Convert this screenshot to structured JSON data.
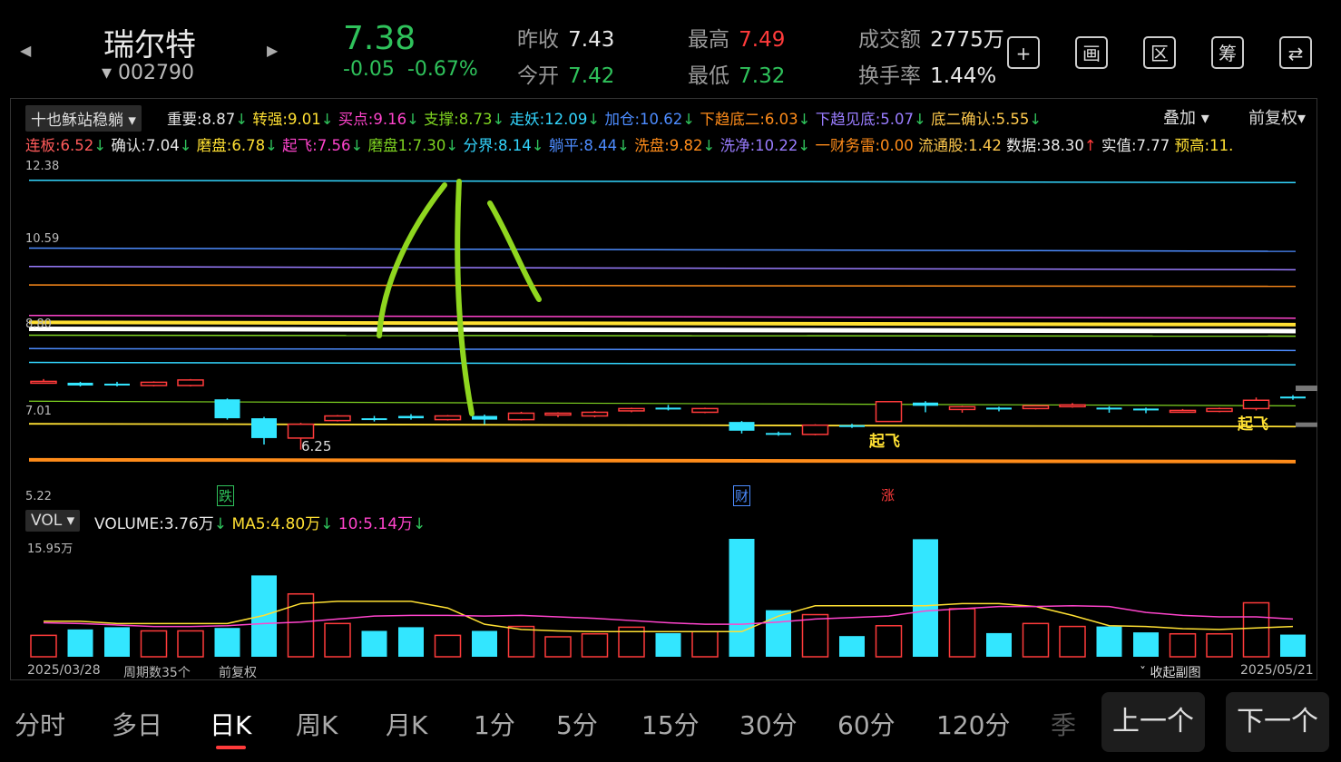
{
  "header": {
    "stock_name": "瑞尔特",
    "stock_code": "002790",
    "price": "7.38",
    "change": "-0.05",
    "change_pct": "-0.67%",
    "quotes": [
      {
        "label": "昨收",
        "value": "7.43",
        "color": "#e8e8e8"
      },
      {
        "label": "今开",
        "value": "7.42",
        "color": "#2fc25b"
      },
      {
        "label": "最高",
        "value": "7.49",
        "color": "#ff3b3b"
      },
      {
        "label": "最低",
        "value": "7.32",
        "color": "#2fc25b"
      },
      {
        "label": "成交额",
        "value": "2775万",
        "color": "#e8e8e8"
      },
      {
        "label": "换手率",
        "value": "1.44%",
        "color": "#e8e8e8"
      }
    ],
    "tools": [
      {
        "name": "add-icon",
        "glyph": "+"
      },
      {
        "name": "draw-icon",
        "glyph": "画"
      },
      {
        "name": "range-icon",
        "glyph": "区"
      },
      {
        "name": "chip-icon",
        "glyph": "筹"
      },
      {
        "name": "device-switch-icon",
        "glyph": "⇄"
      }
    ]
  },
  "indicator": {
    "selector": "十也稣站稳躺",
    "overlay": "叠加",
    "adjust": "前复权",
    "row1": [
      {
        "t": "重要:8.87",
        "c": "#e8e8e8",
        "a": "↓"
      },
      {
        "t": "转强:9.01",
        "c": "#ffe033",
        "a": "↓"
      },
      {
        "t": "买点:9.16",
        "c": "#ff44cc",
        "a": "↓"
      },
      {
        "t": "支撑:8.73",
        "c": "#7ed321",
        "a": "↓"
      },
      {
        "t": "走妖:12.09",
        "c": "#33d6ff",
        "a": "↓"
      },
      {
        "t": "加仓:10.62",
        "c": "#4d8cff",
        "a": "↓"
      },
      {
        "t": "下趋底二:6.03",
        "c": "#ff8c1a",
        "a": "↓"
      },
      {
        "t": "下趋见底:5.07",
        "c": "#9a7dff",
        "a": "↓"
      },
      {
        "t": "底二确认:5.55",
        "c": "#ffc94d",
        "a": "↓"
      }
    ],
    "row2": [
      {
        "t": "连板:6.52",
        "c": "#ff5a5a",
        "a": "↓"
      },
      {
        "t": "确认:7.04",
        "c": "#e8e8e8",
        "a": "↓"
      },
      {
        "t": "磨盘:6.78",
        "c": "#ffe033",
        "a": "↓"
      },
      {
        "t": "起飞:7.56",
        "c": "#ff44cc",
        "a": "↓"
      },
      {
        "t": "磨盘1:7.30",
        "c": "#7ed321",
        "a": "↓"
      },
      {
        "t": "分界:8.14",
        "c": "#33d6ff",
        "a": "↓"
      },
      {
        "t": "躺平:8.44",
        "c": "#4d8cff",
        "a": "↓"
      },
      {
        "t": "洗盘:9.82",
        "c": "#ff8c1a",
        "a": "↓"
      },
      {
        "t": "洗净:10.22",
        "c": "#9a7dff",
        "a": "↓"
      },
      {
        "t": "一财务雷:0.00",
        "c": "#ff8c1a",
        "a": ""
      },
      {
        "t": "流通股:1.42",
        "c": "#ffc94d",
        "a": ""
      },
      {
        "t": "数据:38.30",
        "c": "#e8e8e8",
        "a": "↑"
      },
      {
        "t": "实值:7.77",
        "c": "#e8e8e8",
        "a": ""
      },
      {
        "t": "预高:11.",
        "c": "#ffe033",
        "a": ""
      }
    ]
  },
  "price_axis": {
    "top": "12.38",
    "l2": "10.59",
    "l3": "8.80",
    "l4": "7.01",
    "bottom": "5.22"
  },
  "annotations": {
    "low": "6.25",
    "takeoff1": "起飞",
    "takeoff2": "起飞",
    "fall": "跌",
    "finance": "财",
    "rise": "涨"
  },
  "volume": {
    "selector": "VOL",
    "title": "VOLUME:3.76万",
    "ma5": "MA5:4.80万",
    "ma10": "10:5.14万",
    "max_label": "15.95万"
  },
  "footer": {
    "start_date": "2025/03/28",
    "period": "周期数35个",
    "adjust": "前复权",
    "collapse": "收起副图",
    "end_date": "2025/05/21"
  },
  "tabs": [
    "分时",
    "多日",
    "日K",
    "周K",
    "月K",
    "1分",
    "5分",
    "15分",
    "30分",
    "60分",
    "120分",
    "季"
  ],
  "active_tab": "日K",
  "nav": {
    "prev": "上一个",
    "next": "下一个"
  },
  "chart_data": {
    "type": "candlestick",
    "ylim": [
      5.22,
      12.38
    ],
    "candles": [
      {
        "o": 7.73,
        "c": 7.73,
        "h": 7.78,
        "l": 7.7
      },
      {
        "o": 7.7,
        "c": 7.64,
        "h": 7.72,
        "l": 7.62
      },
      {
        "o": 7.68,
        "c": 7.66,
        "h": 7.72,
        "l": 7.62
      },
      {
        "o": 7.64,
        "c": 7.71,
        "h": 7.73,
        "l": 7.62
      },
      {
        "o": 7.64,
        "c": 7.76,
        "h": 7.78,
        "l": 7.62
      },
      {
        "o": 7.34,
        "c": 6.93,
        "h": 7.36,
        "l": 6.9
      },
      {
        "o": 6.93,
        "c": 6.5,
        "h": 6.96,
        "l": 6.36
      },
      {
        "o": 6.5,
        "c": 6.8,
        "h": 6.83,
        "l": 6.25
      },
      {
        "o": 6.88,
        "c": 6.98,
        "h": 7.0,
        "l": 6.86
      },
      {
        "o": 6.93,
        "c": 6.9,
        "h": 6.98,
        "l": 6.86
      },
      {
        "o": 6.98,
        "c": 6.93,
        "h": 7.02,
        "l": 6.9
      },
      {
        "o": 6.9,
        "c": 6.98,
        "h": 7.0,
        "l": 6.88
      },
      {
        "o": 6.98,
        "c": 6.9,
        "h": 7.01,
        "l": 6.8
      },
      {
        "o": 6.9,
        "c": 7.04,
        "h": 7.07,
        "l": 6.88
      },
      {
        "o": 7.0,
        "c": 7.04,
        "h": 7.06,
        "l": 6.95
      },
      {
        "o": 6.98,
        "c": 7.06,
        "h": 7.09,
        "l": 6.95
      },
      {
        "o": 7.09,
        "c": 7.14,
        "h": 7.16,
        "l": 7.06
      },
      {
        "o": 7.16,
        "c": 7.12,
        "h": 7.22,
        "l": 7.1
      },
      {
        "o": 7.06,
        "c": 7.14,
        "h": 7.16,
        "l": 7.04
      },
      {
        "o": 6.85,
        "c": 6.66,
        "h": 6.87,
        "l": 6.6
      },
      {
        "o": 6.61,
        "c": 6.58,
        "h": 6.64,
        "l": 6.55
      },
      {
        "o": 6.58,
        "c": 6.78,
        "h": 6.8,
        "l": 6.56
      },
      {
        "o": 6.78,
        "c": 6.74,
        "h": 6.81,
        "l": 6.72
      },
      {
        "o": 6.86,
        "c": 7.29,
        "h": 7.3,
        "l": 6.85
      },
      {
        "o": 7.27,
        "c": 7.2,
        "h": 7.3,
        "l": 7.06
      },
      {
        "o": 7.12,
        "c": 7.18,
        "h": 7.2,
        "l": 7.05
      },
      {
        "o": 7.16,
        "c": 7.12,
        "h": 7.18,
        "l": 7.08
      },
      {
        "o": 7.14,
        "c": 7.2,
        "h": 7.22,
        "l": 7.12
      },
      {
        "o": 7.2,
        "c": 7.22,
        "h": 7.26,
        "l": 7.16
      },
      {
        "o": 7.16,
        "c": 7.14,
        "h": 7.19,
        "l": 7.05
      },
      {
        "o": 7.14,
        "c": 7.1,
        "h": 7.16,
        "l": 7.04
      },
      {
        "o": 7.1,
        "c": 7.1,
        "h": 7.13,
        "l": 7.06
      },
      {
        "o": 7.08,
        "c": 7.14,
        "h": 7.16,
        "l": 7.06
      },
      {
        "o": 7.14,
        "c": 7.32,
        "h": 7.38,
        "l": 7.1
      },
      {
        "o": 7.4,
        "c": 7.36,
        "h": 7.43,
        "l": 7.33
      }
    ],
    "lines": [
      {
        "v": 12.09,
        "v2": 12.04,
        "c": "#33d6ff",
        "w": 1.5
      },
      {
        "v": 10.62,
        "v2": 10.55,
        "c": "#4d8cff",
        "w": 1.5
      },
      {
        "v": 10.22,
        "v2": 10.15,
        "c": "#9a7dff",
        "w": 1.5
      },
      {
        "v": 9.82,
        "v2": 9.79,
        "c": "#ff8c1a",
        "w": 1.5
      },
      {
        "v": 9.16,
        "v2": 9.1,
        "c": "#ff44cc",
        "w": 1.5
      },
      {
        "v": 9.01,
        "v2": 8.96,
        "c": "#ffe033",
        "w": 4
      },
      {
        "v": 8.87,
        "v2": 8.82,
        "c": "#ffffff",
        "w": 5
      },
      {
        "v": 8.73,
        "v2": 8.71,
        "c": "#7ed321",
        "w": 1.5
      },
      {
        "v": 8.44,
        "v2": 8.4,
        "c": "#4d8cff",
        "w": 1.5
      },
      {
        "v": 8.14,
        "v2": 8.09,
        "c": "#33d6ff",
        "w": 1.5
      },
      {
        "v": 7.3,
        "v2": 7.2,
        "c": "#7ed321",
        "w": 1.2
      },
      {
        "v": 6.81,
        "v2": 6.75,
        "c": "#ffe033",
        "w": 1.8
      },
      {
        "v": 6.03,
        "v2": 5.99,
        "c": "#ff8c1a",
        "w": 4
      }
    ],
    "volume": [
      2.9,
      3.7,
      4.0,
      3.5,
      3.5,
      3.9,
      11.0,
      8.5,
      4.5,
      3.5,
      4.0,
      2.9,
      3.5,
      4.1,
      2.7,
      3.1,
      4.0,
      3.2,
      3.4,
      15.95,
      6.3,
      5.7,
      2.8,
      4.2,
      15.9,
      6.5,
      3.2,
      4.5,
      4.1,
      4.1,
      3.3,
      3.1,
      3.1,
      7.3,
      3.0
    ],
    "ma5": [
      4.8,
      4.8,
      4.5,
      4.5,
      4.5,
      4.5,
      5.6,
      7.2,
      7.5,
      7.5,
      7.5,
      6.6,
      4.4,
      3.7,
      3.5,
      3.4,
      3.4,
      3.4,
      3.4,
      3.4,
      5.5,
      6.9,
      6.9,
      6.9,
      6.9,
      7.2,
      7.2,
      6.8,
      5.6,
      4.2,
      4.1,
      3.8,
      3.7,
      3.9,
      4.1
    ],
    "ma10": [
      4.6,
      4.5,
      4.3,
      4.1,
      4.1,
      4.2,
      4.5,
      4.7,
      5.1,
      5.5,
      5.6,
      5.6,
      5.5,
      5.6,
      5.4,
      5.2,
      4.9,
      4.6,
      4.4,
      4.4,
      4.7,
      5.1,
      5.3,
      5.5,
      6.2,
      6.5,
      6.8,
      6.8,
      6.9,
      6.8,
      6.0,
      5.6,
      5.4,
      5.4,
      5.1
    ],
    "vol_max": 15.95
  }
}
